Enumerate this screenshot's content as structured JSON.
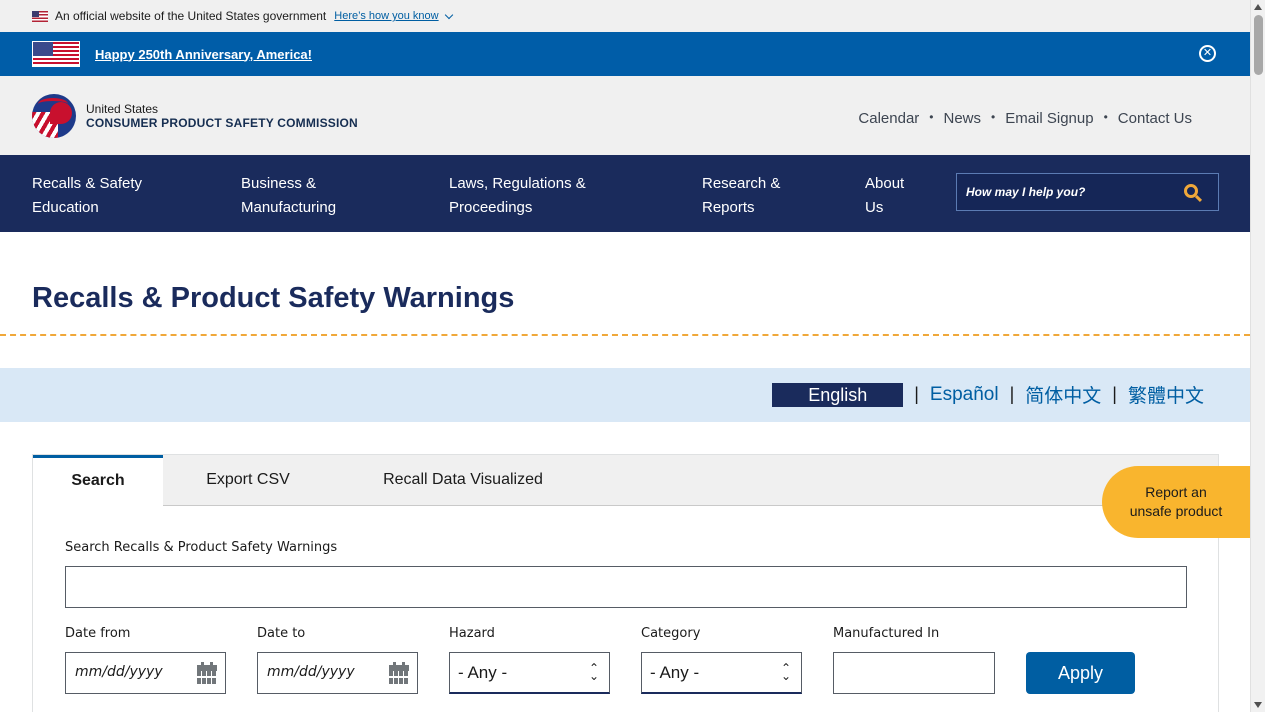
{
  "gov_banner": {
    "text": "An official website of the United States government",
    "link": "Here’s how you know"
  },
  "anniversary": {
    "link": "Happy 250th Anniversary, America!",
    "close_symbol": "✕"
  },
  "header": {
    "brand_top": "United States",
    "brand_bottom": "CONSUMER PRODUCT SAFETY COMMISSION",
    "utility_links": [
      "Calendar",
      "News",
      "Email Signup",
      "Contact Us"
    ],
    "separator": "•"
  },
  "nav": {
    "items": [
      {
        "line1": "Recalls & Safety",
        "line2": "Education"
      },
      {
        "line1": "Business &",
        "line2": "Manufacturing"
      },
      {
        "line1": "Laws, Regulations &",
        "line2": "Proceedings"
      },
      {
        "line1": "Research &",
        "line2": "Reports"
      },
      {
        "line1": "About",
        "line2": "Us"
      }
    ],
    "search_placeholder": "How may I help you?"
  },
  "page_title": "Recalls & Product Safety Warnings",
  "languages": {
    "active": "English",
    "others": [
      "Español",
      "简体中文",
      "繁體中文"
    ],
    "separator": "|"
  },
  "tabs": [
    "Search",
    "Export CSV",
    "Recall Data Visualized"
  ],
  "search_form": {
    "main_label": "Search Recalls & Product Safety Warnings",
    "date_from_label": "Date from",
    "date_to_label": "Date to",
    "date_placeholder": "mm/dd/yyyy",
    "hazard_label": "Hazard",
    "hazard_value": "- Any -",
    "category_label": "Category",
    "category_value": "- Any -",
    "manufactured_label": "Manufactured In",
    "apply_label": "Apply"
  },
  "report_button": {
    "line1": "Report an",
    "line2": "unsafe product"
  },
  "colors": {
    "nav_bg": "#1a2b5c",
    "banner_blue": "#005da8",
    "accent_orange": "#f9b52e",
    "link_blue": "#005ea2"
  }
}
